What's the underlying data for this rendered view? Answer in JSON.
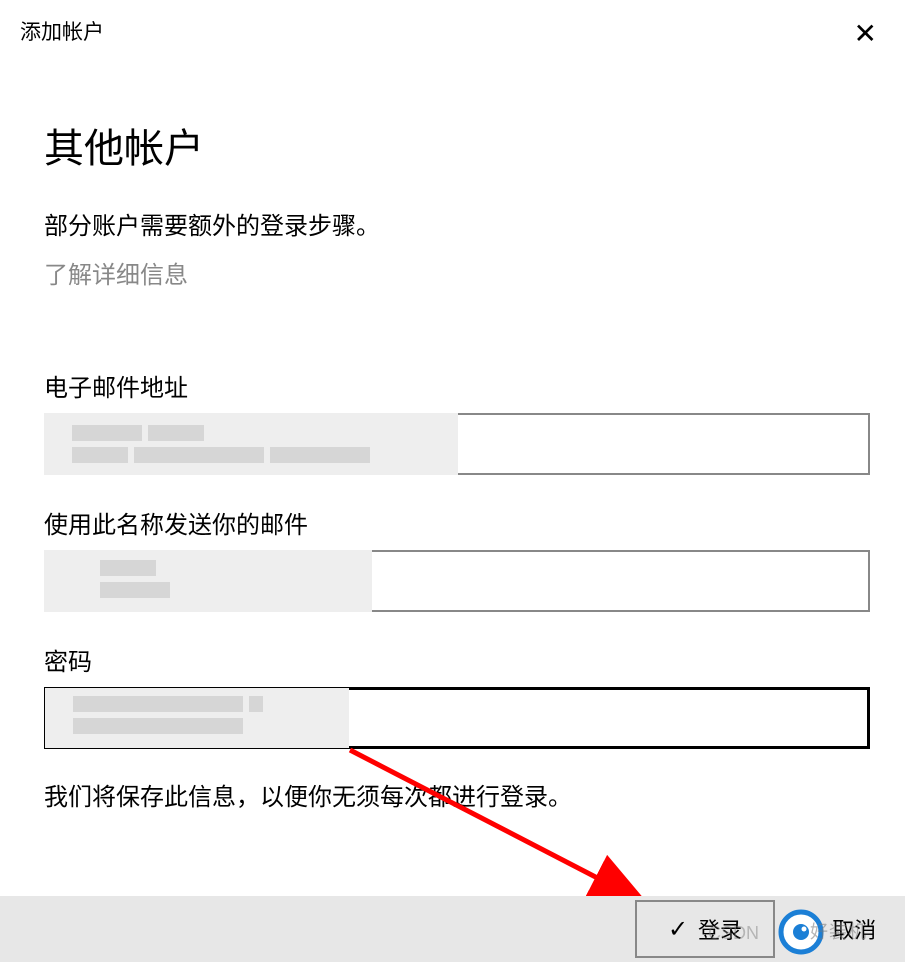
{
  "window": {
    "title": "添加帐户"
  },
  "main": {
    "heading": "其他帐户",
    "subtext": "部分账户需要额外的登录步骤。",
    "learn_more": "了解详细信息"
  },
  "form": {
    "email_label": "电子邮件地址",
    "email_value": "",
    "sendname_label": "使用此名称发送你的邮件",
    "sendname_value": "",
    "password_label": "密码",
    "password_value": "",
    "save_info": "我们将保存此信息，以便你无须每次都进行登录。"
  },
  "footer": {
    "login_label": "登录",
    "cancel_label": "取消"
  },
  "watermark": {
    "text1": "CSDN",
    "text2": "好装机"
  }
}
